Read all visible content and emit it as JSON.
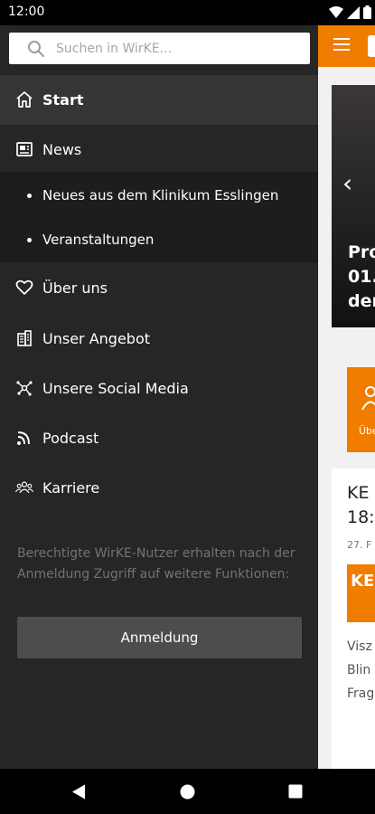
{
  "status": {
    "time": "12:00"
  },
  "search": {
    "placeholder": "Suchen in WirKE..."
  },
  "drawer": {
    "items": [
      {
        "label": "Start",
        "icon": "home-icon"
      },
      {
        "label": "News",
        "icon": "newspaper-icon"
      },
      {
        "label": "Über uns",
        "icon": "heart-icon"
      },
      {
        "label": "Unser Angebot",
        "icon": "building-icon"
      },
      {
        "label": "Unsere Social Media",
        "icon": "network-icon"
      },
      {
        "label": "Podcast",
        "icon": "rss-icon"
      },
      {
        "label": "Karriere",
        "icon": "group-icon"
      }
    ],
    "sub_items": [
      {
        "label": "Neues aus dem Klinikum Esslingen"
      },
      {
        "label": "Veranstaltungen"
      }
    ],
    "login_note": "Berechtigte WirKE-Nutzer erhalten nach der Anmeldung Zugriff auf weitere Funktionen:",
    "login_button": "Anmeldung"
  },
  "background": {
    "hero_text": "Pro\n01.\nder",
    "tile_label": "Übe",
    "card_title": "KE\n18:",
    "card_date": "27. F",
    "card_thumb": "KE",
    "card_excerpt": "Visz\nBlin\nFrag"
  },
  "colors": {
    "accent": "#f07d00",
    "drawer_bg": "#262626",
    "active_item_bg": "#353535",
    "submenu_bg": "#1d1d1d"
  }
}
